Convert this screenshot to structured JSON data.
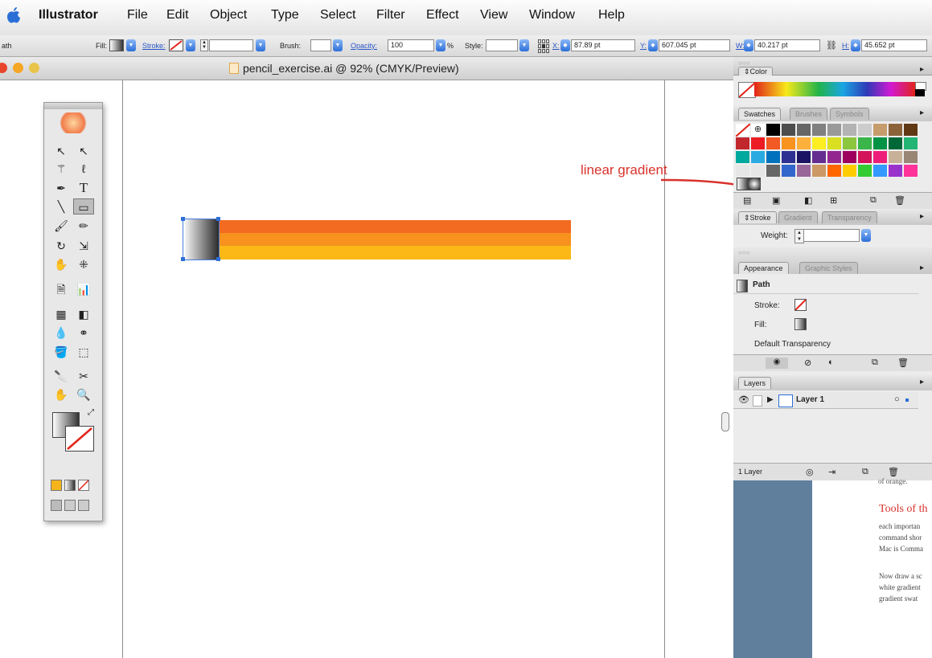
{
  "menubar": {
    "app": "Illustrator",
    "items": [
      "File",
      "Edit",
      "Object",
      "Type",
      "Select",
      "Filter",
      "Effect",
      "View",
      "Window",
      "Help"
    ]
  },
  "control_bar": {
    "object_type": "ath",
    "fill_label": "Fill:",
    "stroke_label": "Stroke:",
    "brush_label": "Brush:",
    "opacity_label": "Opacity:",
    "opacity_value": "100",
    "percent": "%",
    "style_label": "Style:",
    "x_label": "X:",
    "x_value": "87.89 pt",
    "y_label": "Y:",
    "y_value": "607.045 pt",
    "w_label": "W:",
    "w_value": "40.217 pt",
    "h_label": "H:",
    "h_value": "45.652 pt"
  },
  "document": {
    "title": "pencil_exercise.ai @ 92% (CMYK/Preview)"
  },
  "annotation": {
    "text": "linear gradient",
    "color": "#d8322c"
  },
  "colors": {
    "stripe_top": "#f36b21",
    "stripe_mid": "#f7921e",
    "stripe_bot": "#fbb817",
    "accent_blue": "#2d6fd8"
  },
  "panels": {
    "color": {
      "tab": "Color"
    },
    "swatches": {
      "tabs": [
        "Swatches",
        "Brushes",
        "Symbols"
      ]
    },
    "stroke": {
      "tabs": [
        "Stroke",
        "Gradient",
        "Transparency"
      ],
      "weight_label": "Weight:"
    },
    "appearance": {
      "tabs": [
        "Appearance",
        "Graphic Styles"
      ],
      "object": "Path",
      "stroke_label": "Stroke:",
      "fill_label": "Fill:",
      "transparency": "Default Transparency"
    },
    "layers": {
      "tab": "Layers",
      "layer_name": "Layer 1",
      "count": "1 Layer"
    }
  },
  "page_preview": {
    "line1": "of orange.",
    "heading": "Tools of th",
    "p1": [
      "each importan",
      "command shor",
      "Mac is Comma"
    ],
    "p2": [
      "Now draw a sc",
      "white gradient",
      "gradient swat"
    ]
  }
}
